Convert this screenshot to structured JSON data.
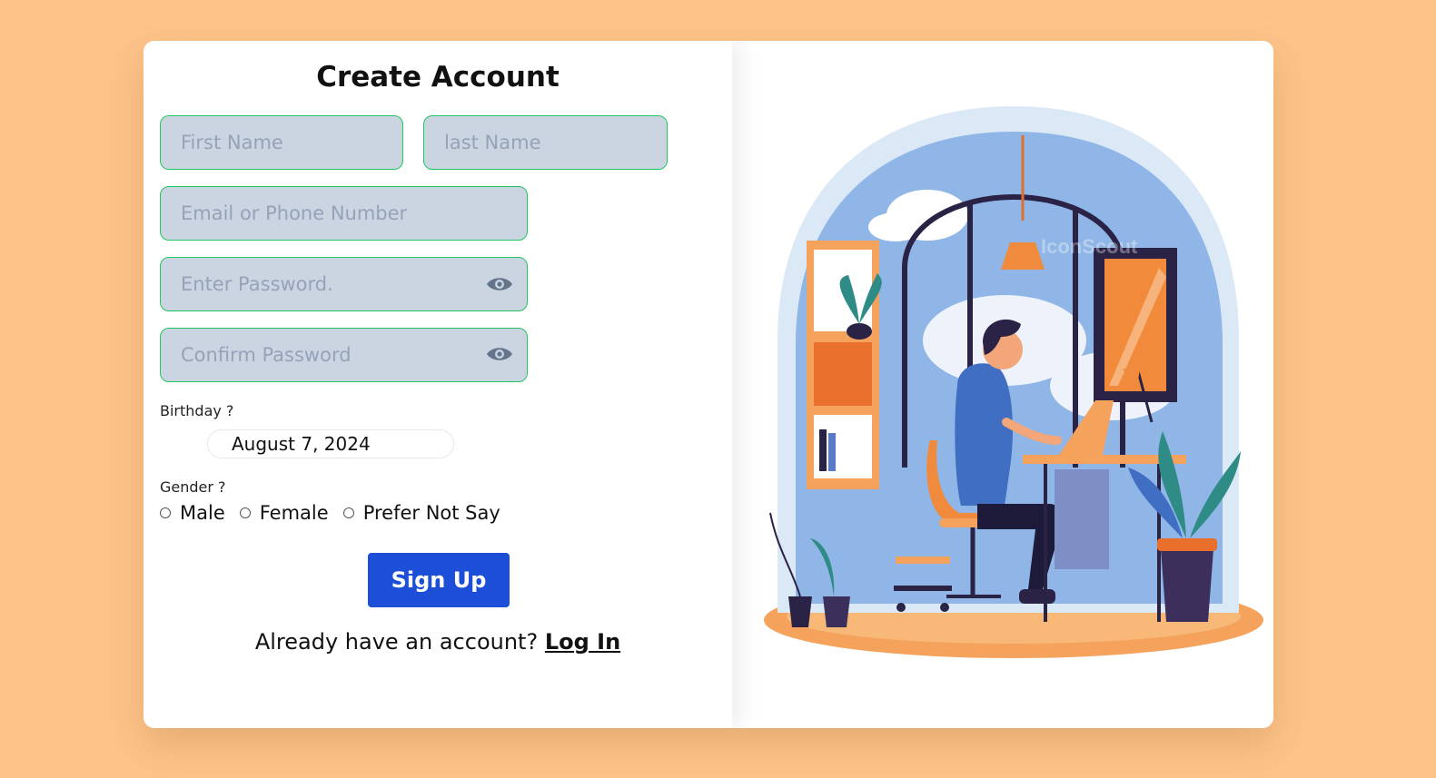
{
  "form": {
    "title": "Create Account",
    "first_name_placeholder": "First Name",
    "last_name_placeholder": "last Name",
    "email_placeholder": "Email or Phone Number",
    "password_placeholder": "Enter Password.",
    "confirm_password_placeholder": "Confirm Password",
    "birthday_label": "Birthday ?",
    "birthday_value": "August 7, 2024",
    "gender_label": "Gender ?",
    "gender_options": [
      "Male",
      "Female",
      "Prefer Not Say"
    ],
    "signup_label": "Sign Up",
    "login_prompt": "Already have an account?",
    "login_link": "Log In"
  },
  "illustration": {
    "subject": "person-working-at-desk-by-window",
    "watermark": "IconScout"
  },
  "colors": {
    "background": "#fdc389",
    "field_fill": "#cbd5e1",
    "field_border": "#22c55e",
    "button": "#1d4ed8"
  }
}
